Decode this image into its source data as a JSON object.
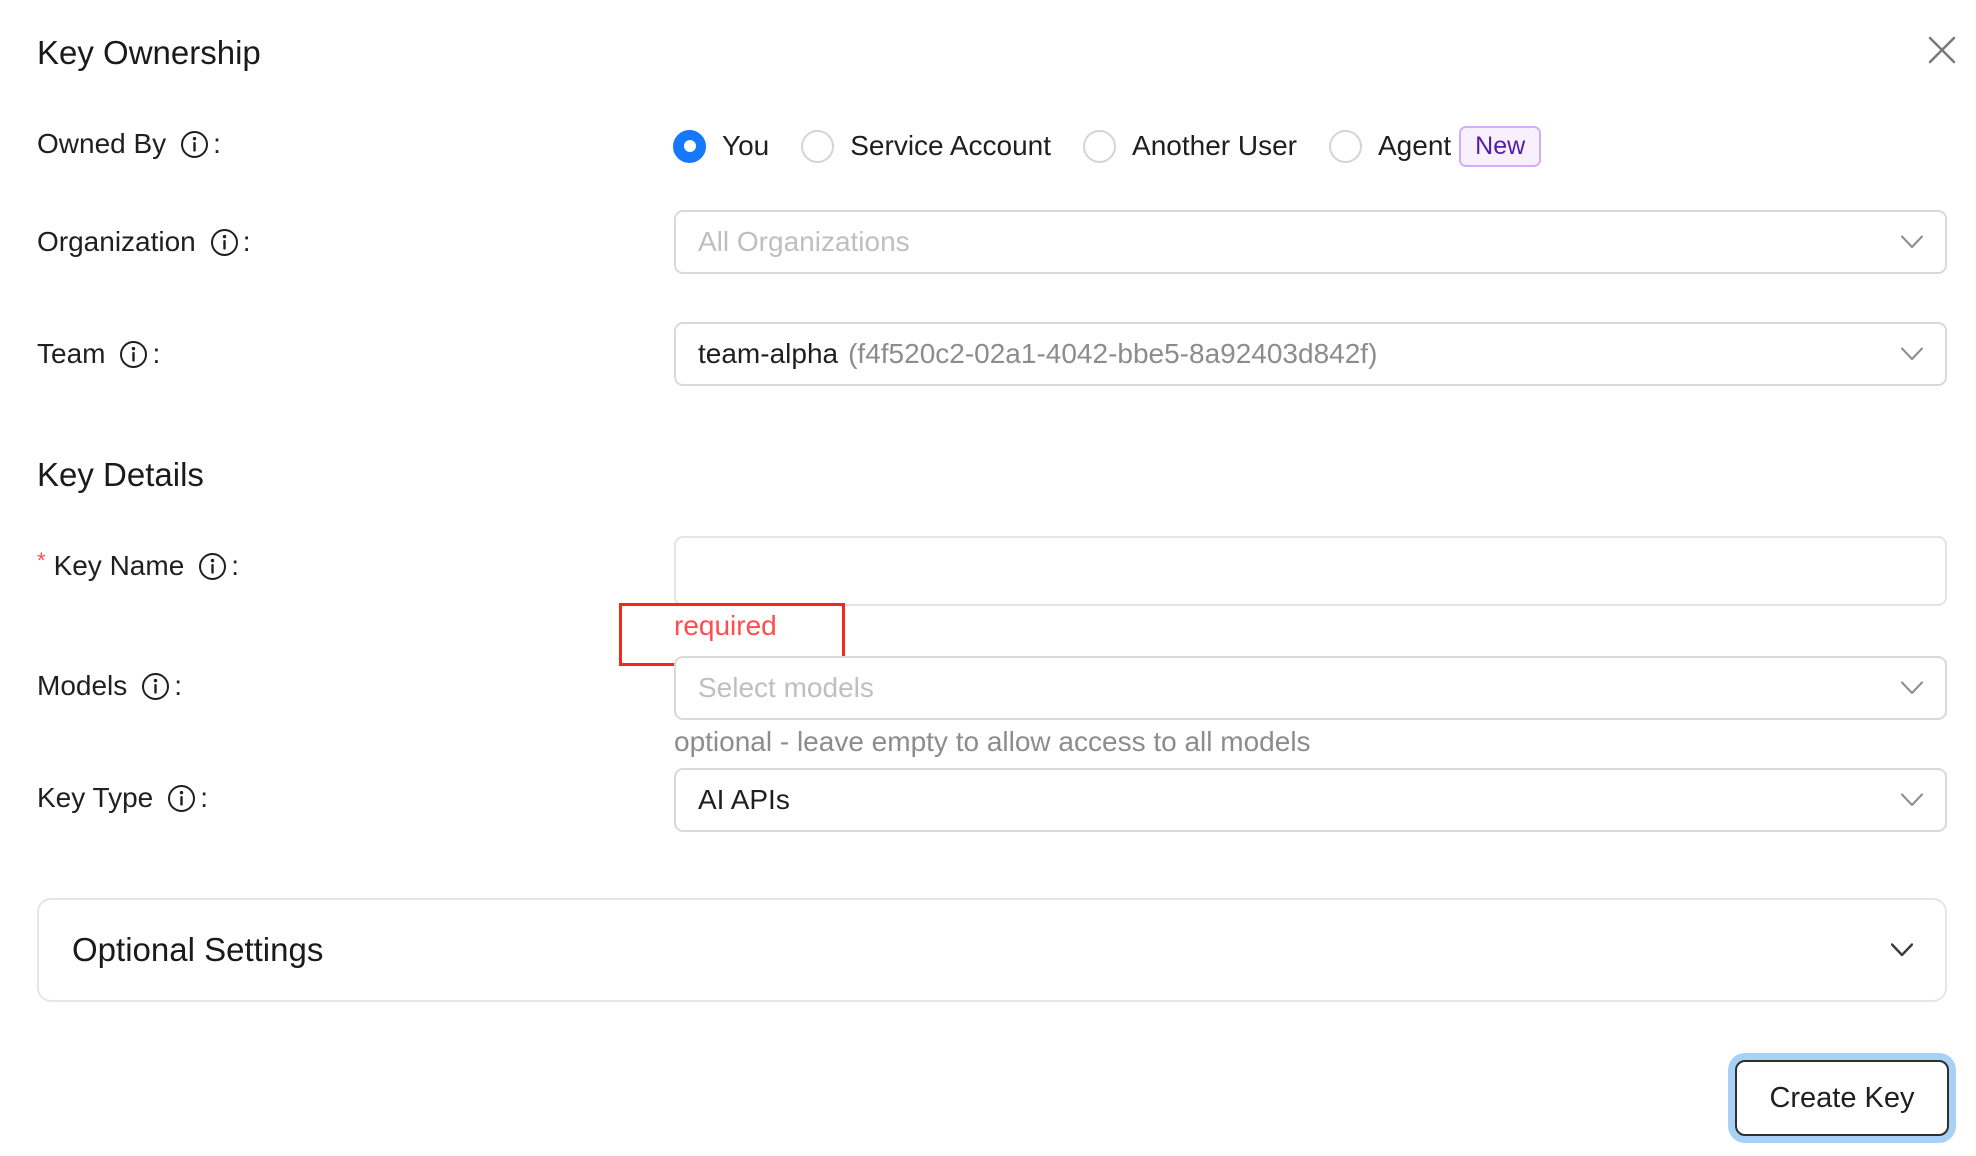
{
  "ownership": {
    "title": "Key Ownership",
    "owned_by_label": "Owned By",
    "owned_by_options": [
      {
        "label": "You",
        "checked": true
      },
      {
        "label": "Service Account",
        "checked": false
      },
      {
        "label": "Another User",
        "checked": false
      },
      {
        "label": "Agent",
        "checked": false,
        "badge": "New"
      }
    ],
    "organization_label": "Organization",
    "organization_placeholder": "All Organizations",
    "team_label": "Team",
    "team_name": "team-alpha",
    "team_id": "(f4f520c2-02a1-4042-bbe5-8a92403d842f)"
  },
  "details": {
    "title": "Key Details",
    "key_name_label": "Key Name",
    "key_name_required_mark": "*",
    "key_name_value": "",
    "key_name_error": "required",
    "models_label": "Models",
    "models_placeholder": "Select models",
    "models_help": "optional - leave empty to allow access to all models",
    "key_type_label": "Key Type",
    "key_type_value": "AI APIs"
  },
  "optional_settings": {
    "title": "Optional Settings"
  },
  "footer": {
    "create_label": "Create Key"
  },
  "colors": {
    "primary": "#1677ff",
    "error": "#ff4d4f",
    "annotation": "#f0281e",
    "badge_text": "#531dab"
  }
}
